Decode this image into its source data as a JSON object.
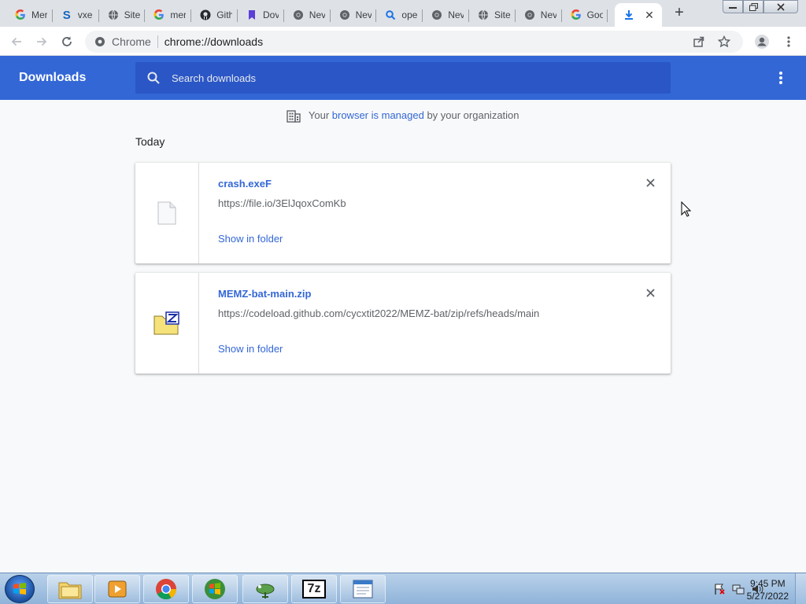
{
  "tabs": [
    {
      "title": "Mer",
      "icon": "google-icon"
    },
    {
      "title": "vxe",
      "icon": "s-icon"
    },
    {
      "title": "Site",
      "icon": "globe-icon"
    },
    {
      "title": "mer",
      "icon": "google-icon"
    },
    {
      "title": "Gith",
      "icon": "github-icon"
    },
    {
      "title": "Dov",
      "icon": "bookmark-icon"
    },
    {
      "title": "Nev",
      "icon": "chrome-icon"
    },
    {
      "title": "Nev",
      "icon": "chrome-icon"
    },
    {
      "title": "ope",
      "icon": "search-icon"
    },
    {
      "title": "Nev",
      "icon": "chrome-icon"
    },
    {
      "title": "Site",
      "icon": "globe-icon"
    },
    {
      "title": "Nev",
      "icon": "chrome-icon"
    },
    {
      "title": "Goo",
      "icon": "google-icon"
    }
  ],
  "active_tab": {
    "icon": "download-icon"
  },
  "omnibox": {
    "chip": "Chrome",
    "url": "chrome://downloads"
  },
  "downloads": {
    "title": "Downloads",
    "search_placeholder": "Search downloads",
    "managed": {
      "pre": "Your ",
      "link": "browser is managed",
      "post": " by your organization"
    },
    "section": "Today",
    "items": [
      {
        "filename": "crash.exeF",
        "url": "https://file.io/3ElJqoxComKb",
        "action": "Show in folder",
        "icon": "file-icon"
      },
      {
        "filename": "MEMZ-bat-main.zip",
        "url": "https://codeload.github.com/cycxtit2022/MEMZ-bat/zip/refs/heads/main",
        "action": "Show in folder",
        "icon": "zip-file-icon"
      }
    ]
  },
  "taskbar": {
    "apps": [
      "file-explorer-icon",
      "media-player-icon",
      "chrome-icon",
      "windows-logo-icon",
      "gecko-icon",
      "7zip-icon",
      "notepad-icon"
    ],
    "apps_label_7z": "7z",
    "time": "9:45 PM",
    "date": "5/27/2022"
  },
  "colors": {
    "accent": "#3367d6",
    "search_bg": "#2a56c6",
    "page_bg": "#f8f9fa"
  }
}
